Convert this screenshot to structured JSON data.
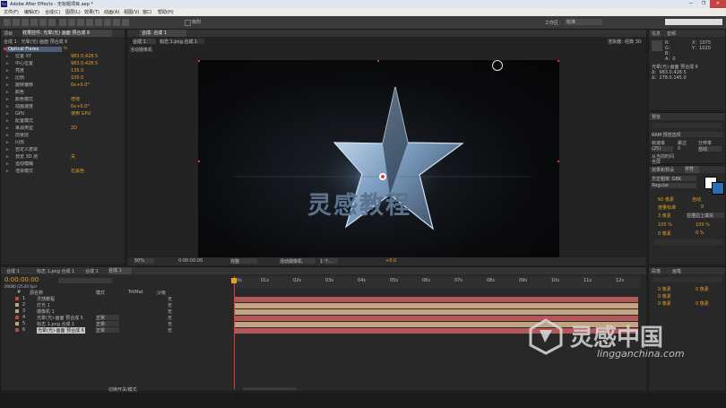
{
  "app": {
    "title": "Adobe After Effects - 无标题项目.aep *",
    "window_controls": [
      "—",
      "❐",
      "✕"
    ]
  },
  "menu": [
    "文件(F)",
    "编辑(E)",
    "合成(C)",
    "图层(L)",
    "效果(T)",
    "动画(A)",
    "视图(V)",
    "窗口",
    "帮助(H)"
  ],
  "toolbar": {
    "snap_label": "吸附",
    "workspace_label": "工作区：",
    "workspace_value": "标准",
    "search_placeholder": "搜索帮助"
  },
  "effect_controls": {
    "tab_project": "项目",
    "tab_effects": "效果控件: 光晕(光) 画面 预合成 6",
    "header": "合成 1 · 光晕(光)·画面 预合成 6",
    "effect_name": "Optical Flares",
    "params": [
      {
        "label": "位置 XY",
        "value": "983.0,428.5"
      },
      {
        "label": "中心位置",
        "value": "983.0,428.5"
      },
      {
        "label": "亮度",
        "value": "135.0"
      },
      {
        "label": "比例",
        "value": "100.0"
      },
      {
        "label": "旋转偏移",
        "value": "0x+0.0°"
      },
      {
        "label": "颜色",
        "value": ""
      },
      {
        "label": "颜色模式",
        "value": "倍增"
      },
      {
        "label": "动画速度",
        "value": "0x+0.0°"
      },
      {
        "label": "GPU",
        "value": "使用 GPU"
      },
      {
        "label": "配置模式",
        "value": ""
      },
      {
        "label": "来源类型",
        "value": "2D"
      },
      {
        "label": "前景层",
        "value": ""
      },
      {
        "label": "闪烁",
        "value": ""
      },
      {
        "label": "自定义遮罩",
        "value": ""
      },
      {
        "label": "预览 3D 层",
        "value": "关"
      },
      {
        "label": "运动模糊",
        "value": ""
      },
      {
        "label": "渲染模式",
        "value": "在黑色"
      }
    ]
  },
  "composition": {
    "tab_label": "合成: 合成 1",
    "breadcrumb": [
      "合成 1",
      "标志 1.png 合成 1"
    ],
    "renderer_label": "渲染器：",
    "renderer_value": "经典 3D",
    "view_label": "活动摄像机",
    "canvas_title": "灵感教程",
    "footer": {
      "zoom": "50%",
      "time": "0:00:00:00",
      "resolution": "完整",
      "camera": "活动摄像机",
      "views": "1 个...",
      "exposure": "+0.0"
    }
  },
  "info_panel": {
    "tab_info": "信息",
    "tab_audio": "音频",
    "lines": [
      "R：",
      "G：",
      "B：",
      "A：0"
    ],
    "coords": [
      "X：1075",
      "Y：1020"
    ],
    "desc": [
      "光晕(光)·画面 预合成 6",
      "Δ：983.0,428.5",
      "Δ：278.0,145.0"
    ]
  },
  "preview_panel": {
    "tab": "预览",
    "ram_label": "RAM 预览选项",
    "frame_rate_label": "帧速率",
    "skip_label": "跳过",
    "resolution_label": "分辨率",
    "frame_rate": "(25)",
    "skip": "0",
    "resolution": "自动",
    "from_current": "从当前时间",
    "full_screen": "全屏"
  },
  "character_panel": {
    "tab_effects": "效果和预设",
    "tab_char": "字符",
    "font": "方正粗宋_GBK",
    "style": "Regular",
    "size": "60 像素",
    "leading": "自动",
    "kerning": "度量标准",
    "tracking": "0",
    "stroke": "3 像素",
    "stroke_mode": "在描边上填充",
    "vscale": "100 %",
    "hscale": "100 %",
    "baseline": "0 像素",
    "tsume": "0 %"
  },
  "paragraph_panel": {
    "tab_para": "段落",
    "tab_brush": "画笔",
    "values": [
      "0 像素",
      "0 像素",
      "0 像素",
      "0 像素",
      "0 像素"
    ]
  },
  "timeline": {
    "tabs": [
      "合成 1",
      "标志 1.png 合成 1",
      "合成 1",
      "合成 1"
    ],
    "timecode": "0:00:00:00",
    "frames": "00000 (25.00 fps)",
    "columns": {
      "num": "#",
      "source": "源名称",
      "mode": "模式",
      "trkmat": "TrkMat",
      "parent": "父级"
    },
    "ruler": [
      "00s",
      "01s",
      "02s",
      "03s",
      "04s",
      "05s",
      "06s",
      "07s",
      "08s",
      "09s",
      "10s",
      "11s",
      "12s"
    ],
    "layers": [
      {
        "num": "1",
        "name": "灵感教程",
        "color": "#b14b4b",
        "mode": "",
        "parent": "无"
      },
      {
        "num": "2",
        "name": "灯光 1",
        "color": "#c4a480",
        "mode": "",
        "parent": "无"
      },
      {
        "num": "3",
        "name": "摄像机 1",
        "color": "#c4a480",
        "mode": "",
        "parent": "无"
      },
      {
        "num": "4",
        "name": "光晕(光)·画面 预合成 5",
        "color": "#b14b4b",
        "mode": "正常",
        "parent": "无"
      },
      {
        "num": "5",
        "name": "标志 1.png 合成 1",
        "color": "#c4a480",
        "mode": "正常",
        "parent": "无"
      },
      {
        "num": "6",
        "name": "光晕(光)·画面 预合成 6",
        "color": "#b14b4b",
        "mode": "正常",
        "parent": "无"
      }
    ],
    "bottom_label": "切换开关/模式"
  },
  "watermark": {
    "text": "灵感中国",
    "url": "lingganchina.com"
  },
  "colors": {
    "accent_orange": "#e3a02a",
    "track_red": "#b15959",
    "track_tan": "#c4a480",
    "comp_bg": "#0a0a0c"
  }
}
